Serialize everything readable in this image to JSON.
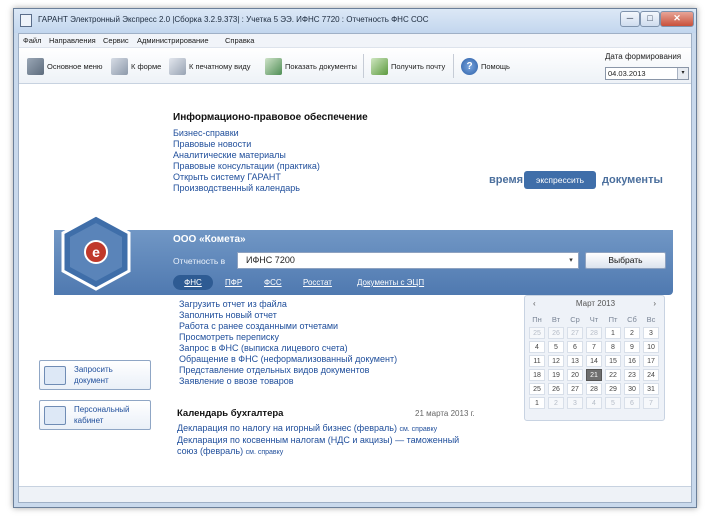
{
  "window": {
    "title": "ГАРАНТ Электронный Экспресс 2.0 |Сборка 3.2.9.373| : Учетка 5 ЭЭ. ИФНС 7720 : Отчетность ФНС СОС",
    "min_glyph": "─",
    "max_glyph": "□",
    "close_glyph": "✕"
  },
  "menu": [
    "Файл",
    "Направления",
    "Сервис",
    "Администрирование",
    "Справка"
  ],
  "toolbar": {
    "main_menu": "Основное меню",
    "to_form": "К форме",
    "to_print": "К печатному виду",
    "show_docs": "Показать документы",
    "get_mail": "Получить почту",
    "help": "Помощь",
    "date_label": "Дата формирования",
    "date_value": "04.03.2013",
    "date_drop": "▾"
  },
  "info": {
    "title": "Информационо-правовое обеспечение",
    "links": [
      "Бизнес-справки",
      "Правовые новости",
      "Аналитические материалы",
      "Правовые консультации (практика)",
      "Открыть систему ГАРАНТ",
      "Производственный календарь"
    ]
  },
  "promo": {
    "left": "время",
    "button": "экспрессить",
    "right": "документы"
  },
  "reporting": {
    "company": "ООО «Комета»",
    "label": "Отчетность в",
    "inspection": "ИФНС 7200",
    "drop": "▾",
    "choose": "Выбрать",
    "tabs": [
      "ФНС",
      "ПФР",
      "ФСС",
      "Росстат",
      "Документы с ЭЦП"
    ]
  },
  "tasks": [
    "Загрузить отчет из файла",
    "Заполнить новый отчет",
    "Работа с ранее созданными отчетами",
    "Просмотреть переписку",
    "Запрос в ФНС (выписка лицевого счета)",
    "Обращение в ФНС (неформализованный документ)",
    "Представление отдельных видов документов",
    "Заявление о ввозе товаров"
  ],
  "side": {
    "request": [
      "Запросить",
      "документ"
    ],
    "cabinet": [
      "Персональный",
      "кабинет"
    ]
  },
  "accounting": {
    "title": "Календарь бухгалтера",
    "date": "21 марта 2013 г.",
    "items": [
      {
        "text": "Декларация по налогу на игорный бизнес (февраль)",
        "ref": "см. справку"
      },
      {
        "text": "Декларация по косвенным налогам (НДС и акцизы) — таможенный",
        "ref": ""
      },
      {
        "text": "союз (февраль)",
        "ref": "см. справку"
      }
    ]
  },
  "calendar": {
    "month": "Март 2013",
    "prev": "‹",
    "next": "›",
    "weekdays": [
      "Пн",
      "Вт",
      "Ср",
      "Чт",
      "Пт",
      "Сб",
      "Вс"
    ],
    "weeks": [
      [
        "25",
        "26",
        "27",
        "28",
        "1",
        "2",
        "3"
      ],
      [
        "4",
        "5",
        "6",
        "7",
        "8",
        "9",
        "10"
      ],
      [
        "11",
        "12",
        "13",
        "14",
        "15",
        "16",
        "17"
      ],
      [
        "18",
        "19",
        "20",
        "21",
        "22",
        "23",
        "24"
      ],
      [
        "25",
        "26",
        "27",
        "28",
        "29",
        "30",
        "31"
      ],
      [
        "1",
        "2",
        "3",
        "4",
        "5",
        "6",
        "7"
      ]
    ],
    "today": "21"
  },
  "colors": {
    "accent": "#3f6ea9",
    "link": "#1f4e9b",
    "band": "#5a84b9"
  }
}
